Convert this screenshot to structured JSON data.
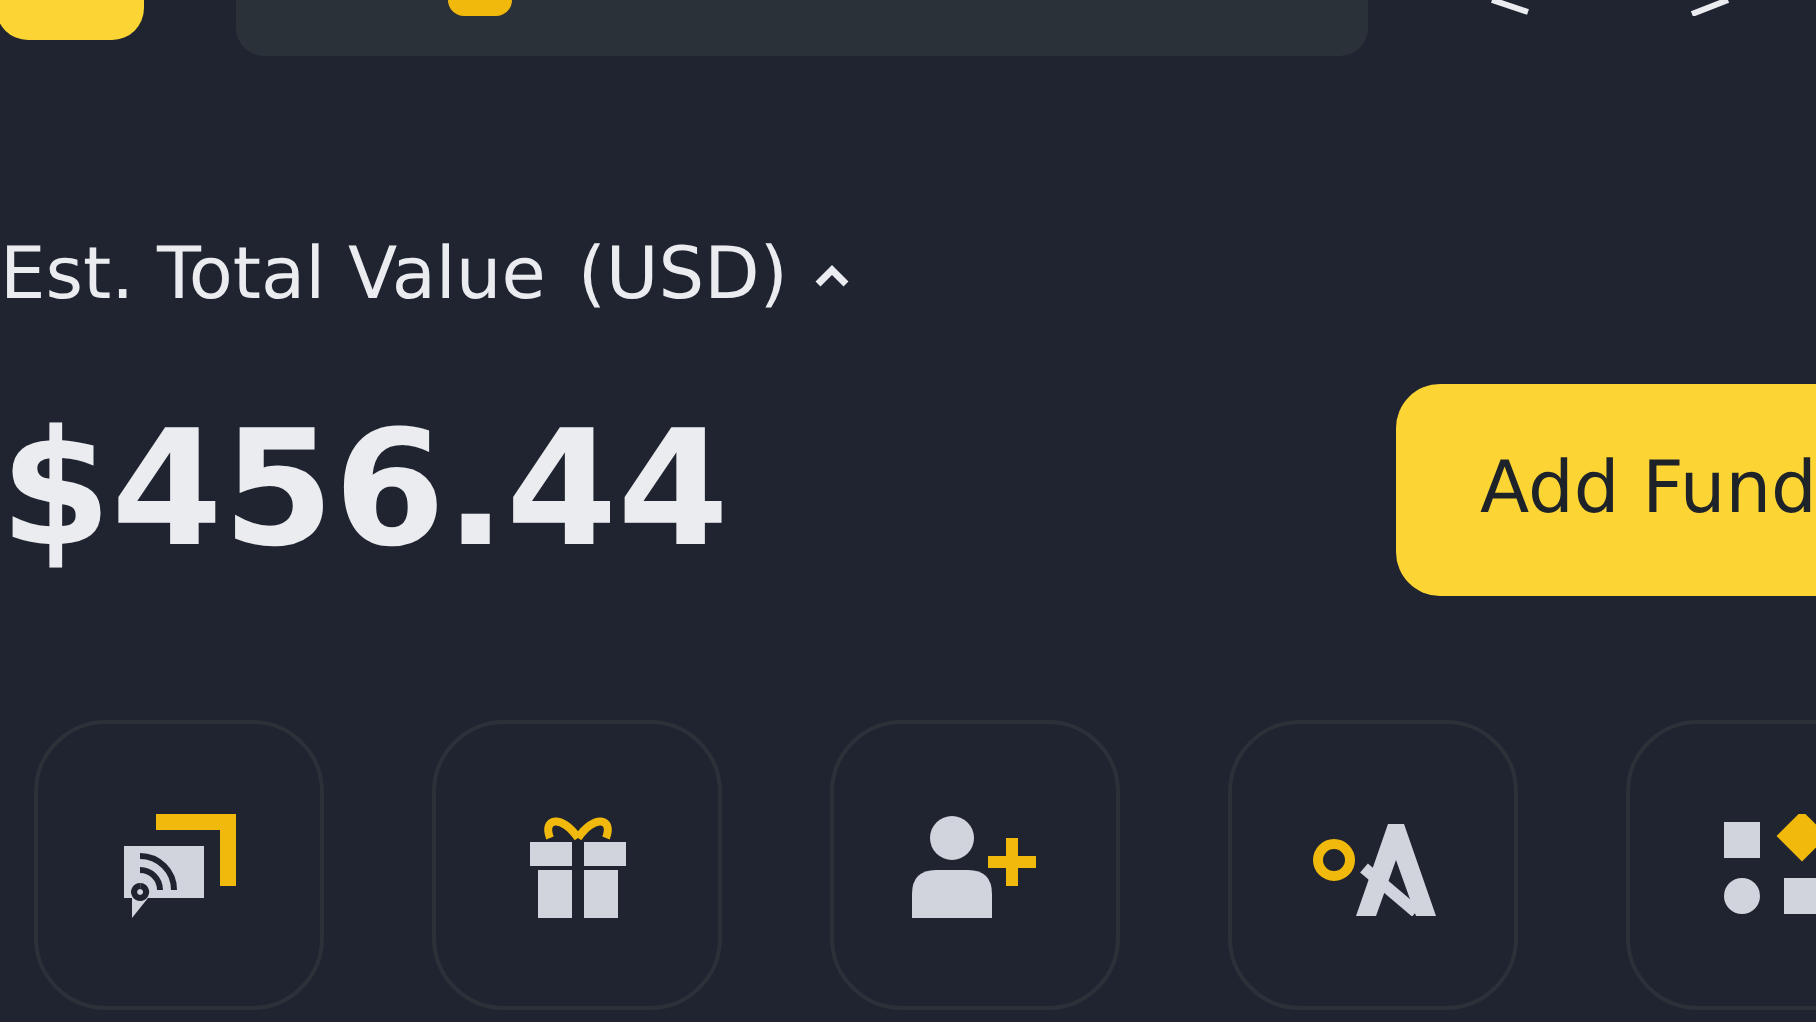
{
  "balance": {
    "label": "Est. Total Value",
    "currency": "(USD)",
    "amount": "$456.44",
    "expanded": true
  },
  "actions": {
    "add_funds": "Add Fund"
  }
}
